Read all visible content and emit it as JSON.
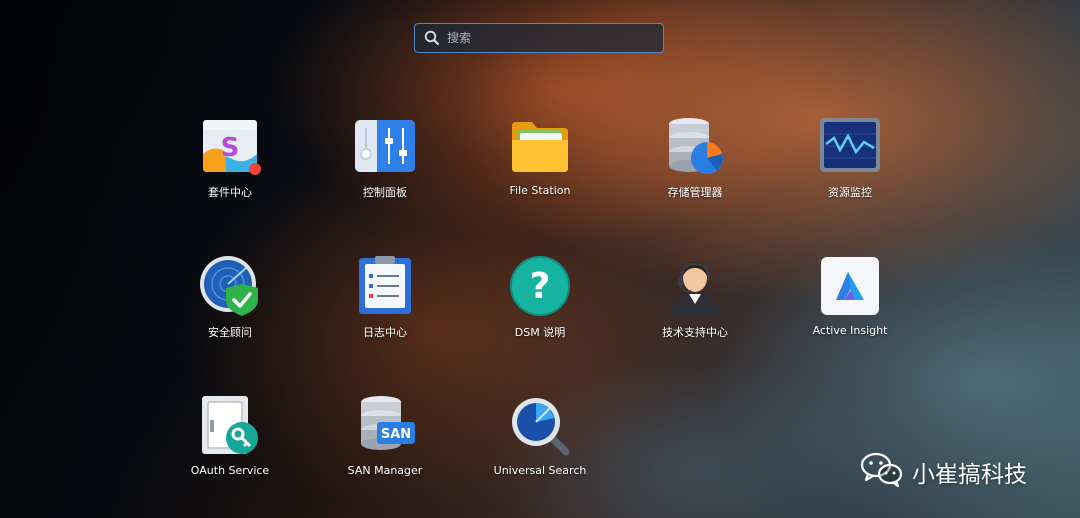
{
  "search": {
    "placeholder": "搜索",
    "icon": "search-icon"
  },
  "apps": [
    {
      "label": "套件中心",
      "icon": "package-center-icon"
    },
    {
      "label": "控制面板",
      "icon": "control-panel-icon"
    },
    {
      "label": "File Station",
      "icon": "folder-icon"
    },
    {
      "label": "存储管理器",
      "icon": "storage-manager-icon"
    },
    {
      "label": "资源监控",
      "icon": "resource-monitor-icon"
    },
    {
      "label": "安全顾问",
      "icon": "security-advisor-icon"
    },
    {
      "label": "日志中心",
      "icon": "log-center-icon"
    },
    {
      "label": "DSM 说明",
      "icon": "help-icon"
    },
    {
      "label": "技术支持中心",
      "icon": "support-center-icon"
    },
    {
      "label": "Active Insight",
      "icon": "active-insight-icon"
    },
    {
      "label": "OAuth Service",
      "icon": "oauth-service-icon"
    },
    {
      "label": "SAN Manager",
      "icon": "san-manager-icon"
    },
    {
      "label": "Universal Search",
      "icon": "universal-search-icon"
    }
  ],
  "watermark": {
    "text": "小崔搞科技",
    "icon": "wechat-icon"
  },
  "colors": {
    "search_border": "#4f87c8",
    "label": "#ffffff"
  }
}
